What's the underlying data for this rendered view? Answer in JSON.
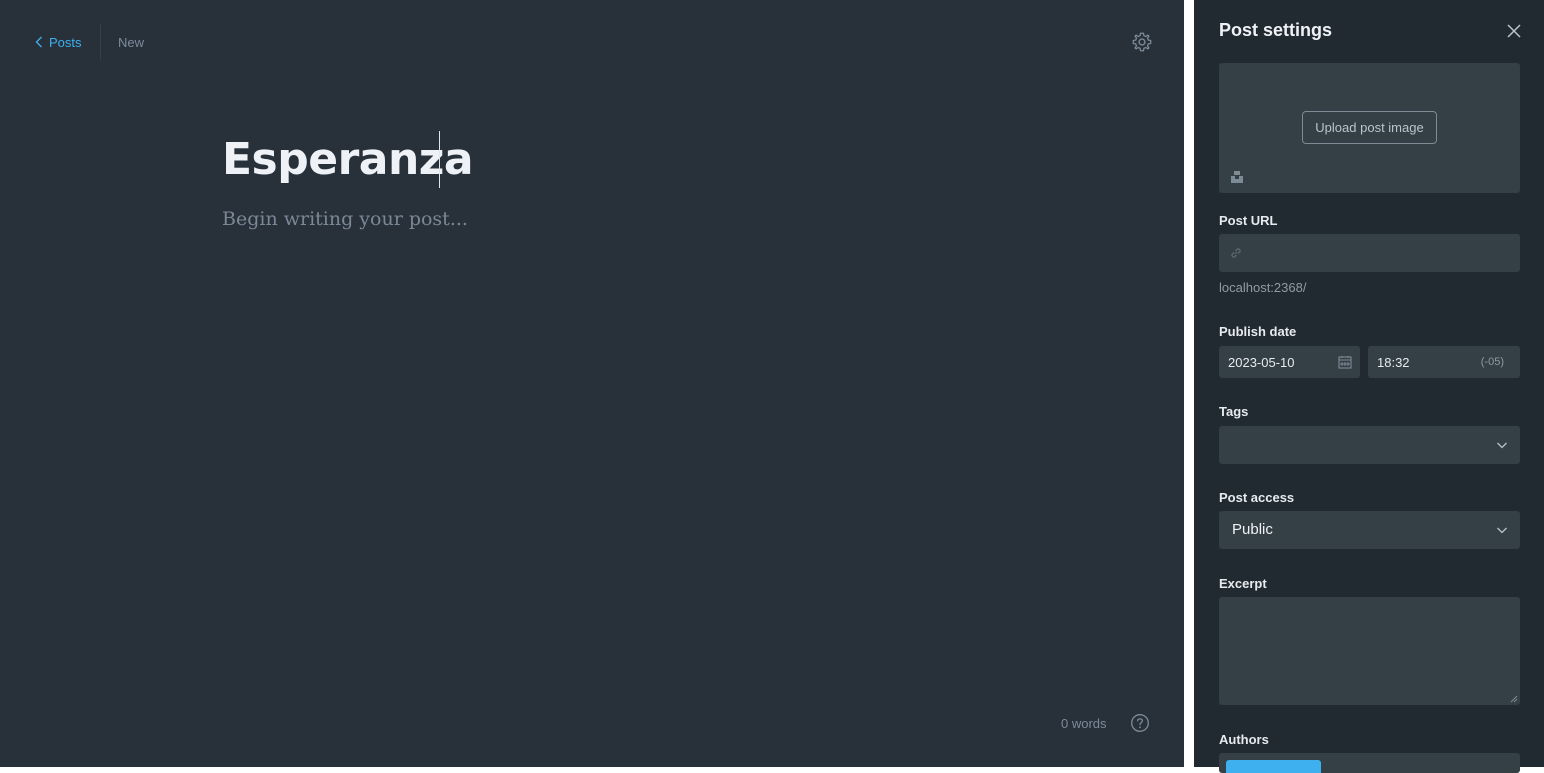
{
  "editor": {
    "back_label": "Posts",
    "status": "New",
    "title": "Esperanza",
    "body_placeholder": "Begin writing your post...",
    "word_count": "0 words"
  },
  "settings": {
    "title": "Post settings",
    "upload_label": "Upload post image",
    "post_url_label": "Post URL",
    "post_url_value": "",
    "post_url_hint": "localhost:2368/",
    "publish_date_label": "Publish date",
    "publish_date": "2023-05-10",
    "publish_time": "18:32",
    "timezone": "(-05)",
    "tags_label": "Tags",
    "access_label": "Post access",
    "access_value": "Public",
    "excerpt_label": "Excerpt",
    "authors_label": "Authors"
  },
  "colors": {
    "accent": "#3eb0ef",
    "editor_bg": "#28313a",
    "panel_bg": "#212a31",
    "input_bg": "#343f46"
  },
  "icons": [
    "chevron-left-icon",
    "gear-icon",
    "close-icon",
    "unsplash-icon",
    "link-icon",
    "calendar-icon",
    "chevron-down-icon",
    "help-icon"
  ]
}
